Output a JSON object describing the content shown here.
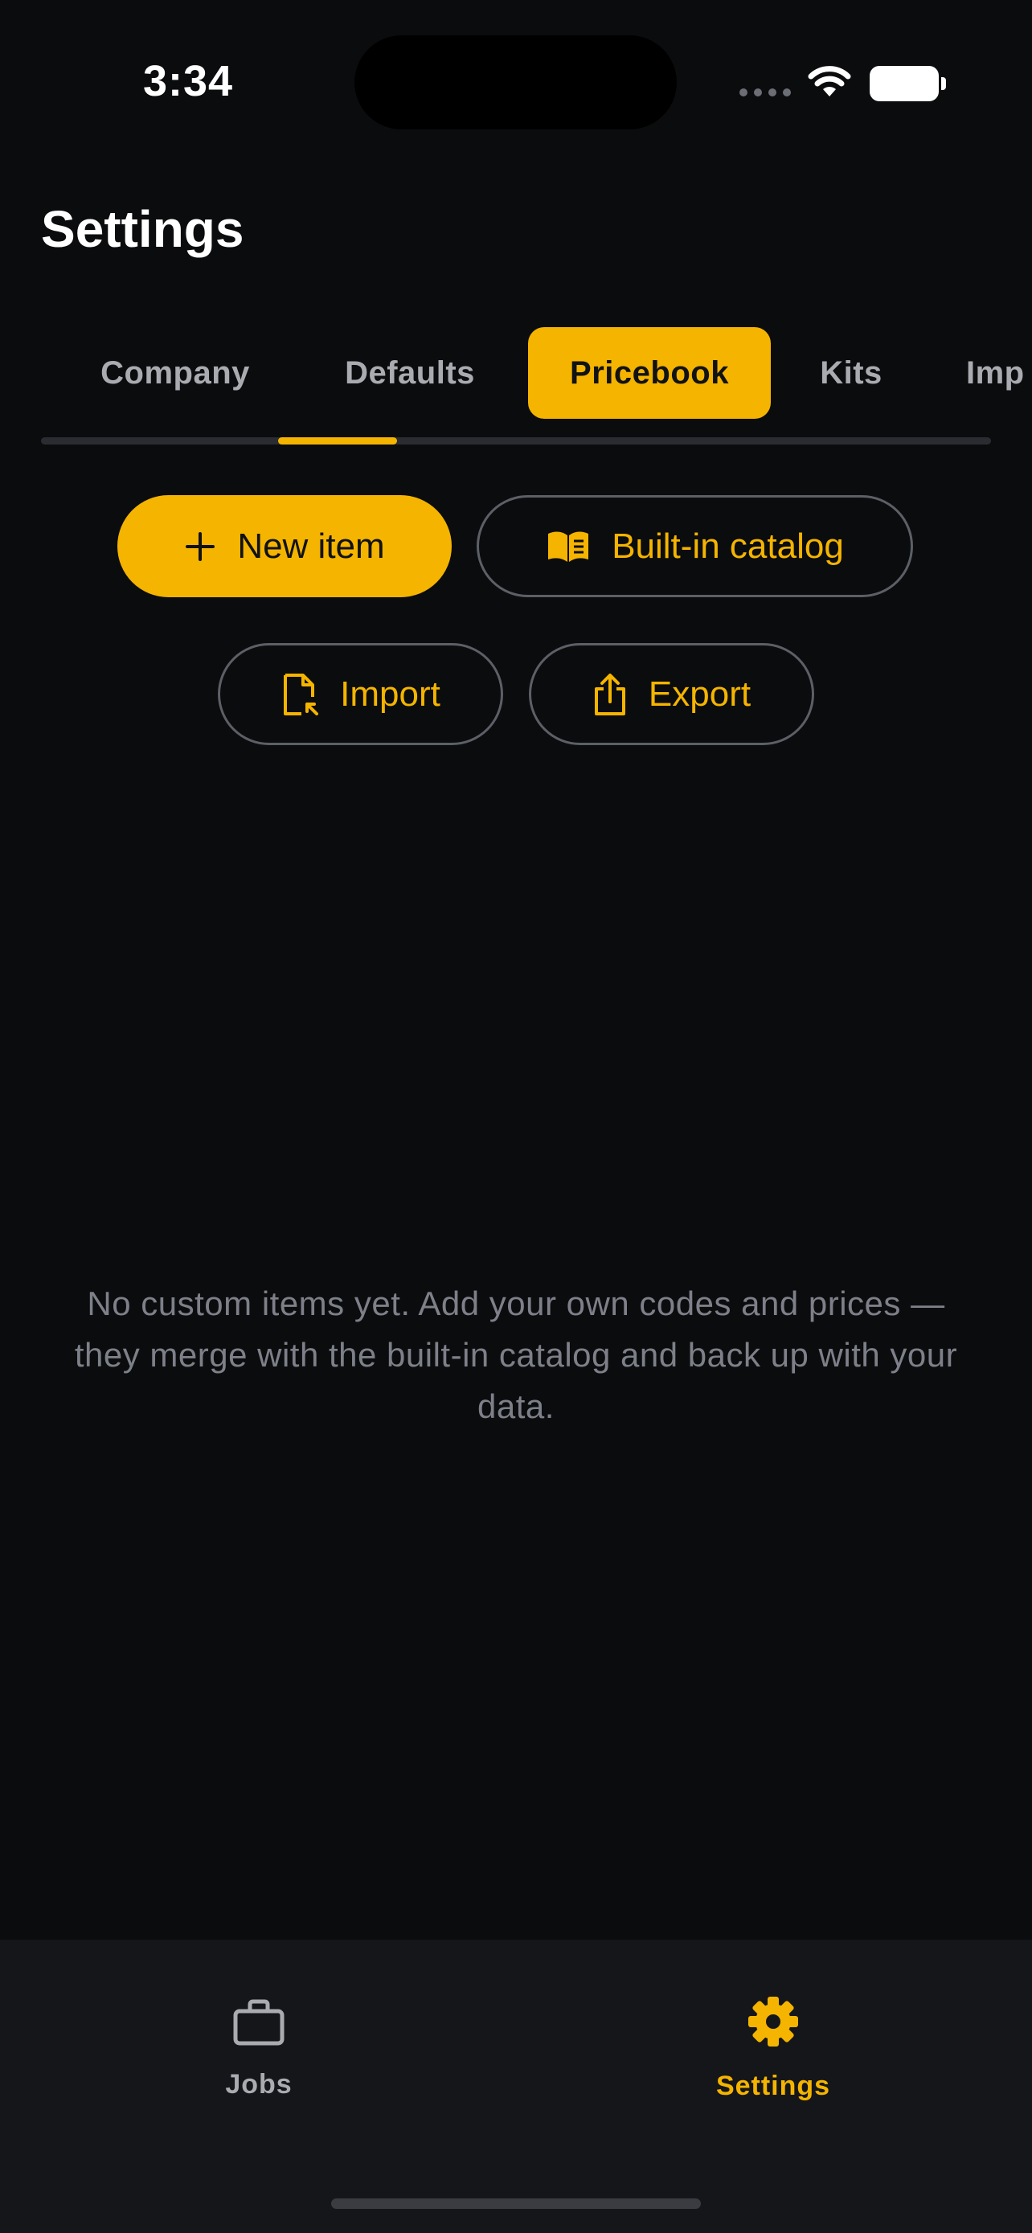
{
  "status_bar": {
    "time": "3:34"
  },
  "page": {
    "title": "Settings"
  },
  "tabs": [
    {
      "label": "Company",
      "active": false
    },
    {
      "label": "Defaults",
      "active": false
    },
    {
      "label": "Pricebook",
      "active": true
    },
    {
      "label": "Kits",
      "active": false
    },
    {
      "label": "Imp",
      "active": false
    }
  ],
  "actions": {
    "new_item": {
      "label": "New item",
      "icon": "plus-icon"
    },
    "catalog": {
      "label": "Built-in catalog",
      "icon": "book-icon"
    },
    "import": {
      "label": "Import",
      "icon": "file-import-icon"
    },
    "export": {
      "label": "Export",
      "icon": "share-icon"
    }
  },
  "empty_state": {
    "message": "No custom items yet. Add your own codes and prices — they merge with the built-in catalog and back up with your data."
  },
  "bottom_nav": [
    {
      "label": "Jobs",
      "icon": "briefcase-icon",
      "active": false
    },
    {
      "label": "Settings",
      "icon": "gear-icon",
      "active": true
    }
  ],
  "colors": {
    "background": "#0b0c0e",
    "accent": "#f4b400",
    "nav_background": "#151619",
    "muted_text": "#7d8089"
  }
}
